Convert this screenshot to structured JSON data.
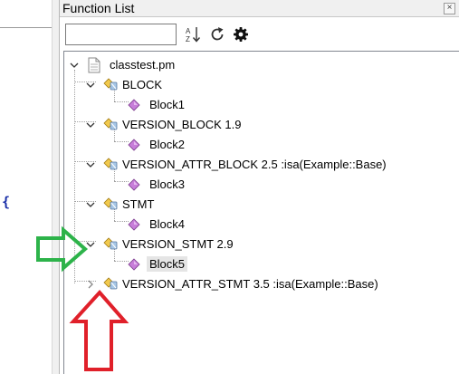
{
  "panel": {
    "title": "Function List",
    "close_glyph": "×",
    "search": {
      "value": "",
      "placeholder": ""
    },
    "toolbar": {
      "sort_icon": "sort-az-icon",
      "reload_icon": "reload-icon",
      "settings_icon": "gear-icon"
    }
  },
  "editor": {
    "brace": "{"
  },
  "tree": {
    "root": "classtest.pm",
    "groups": [
      {
        "label": "BLOCK",
        "child": "Block1",
        "expanded": true
      },
      {
        "label": "VERSION_BLOCK 1.9",
        "child": "Block2",
        "expanded": true
      },
      {
        "label": "VERSION_ATTR_BLOCK 2.5 :isa(Example::Base)",
        "child": "Block3",
        "expanded": true
      },
      {
        "label": "STMT",
        "child": "Block4",
        "expanded": true
      },
      {
        "label": "VERSION_STMT 2.9",
        "child": "Block5",
        "expanded": true,
        "child_selected": true
      },
      {
        "label": "VERSION_ATTR_STMT 3.5 :isa(Example::Base)",
        "child": "",
        "expanded": false
      }
    ]
  },
  "annotations": {
    "green_arrow_color": "#2db34a",
    "red_arrow_color": "#e0202a"
  }
}
